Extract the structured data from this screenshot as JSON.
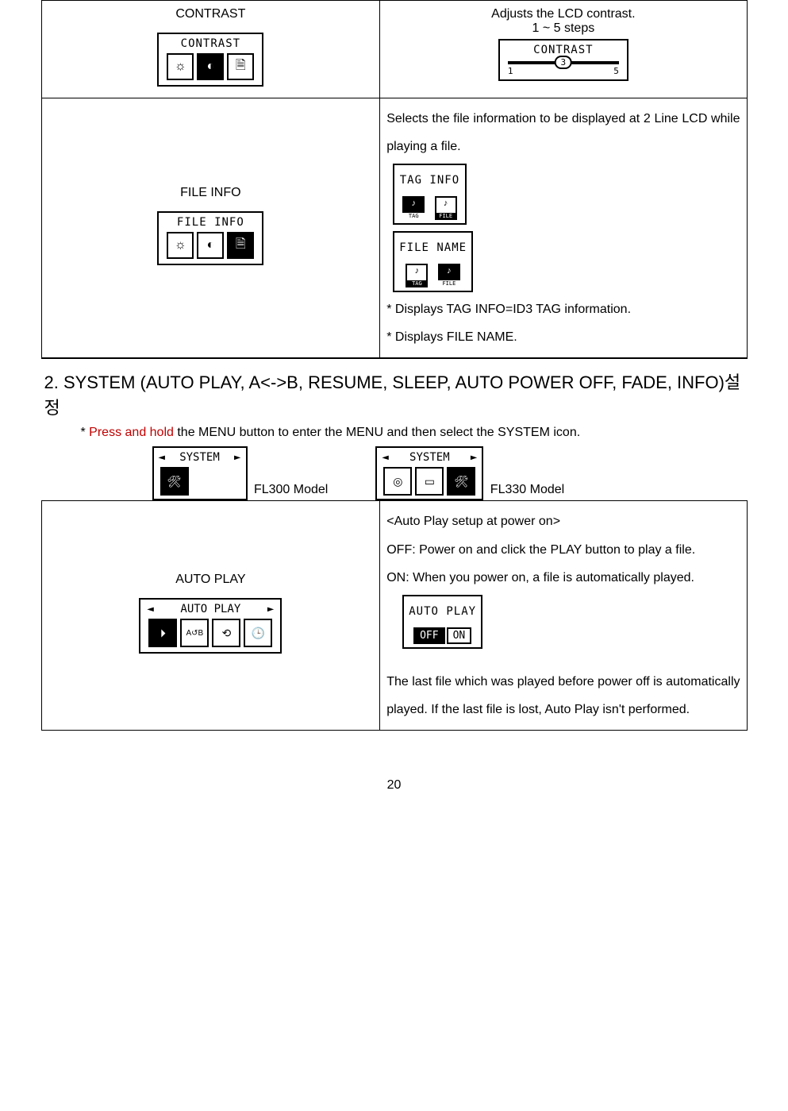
{
  "contrast_row": {
    "title": "CONTRAST",
    "lcd_label": "CONTRAST",
    "desc1": "Adjusts the LCD contrast.",
    "desc2": "1 ~ 5 steps",
    "slider_label": "CONTRAST",
    "slider_value": "3",
    "slider_min": "1",
    "slider_max": "5"
  },
  "fileinfo_row": {
    "title": "FILE INFO",
    "lcd_label": "FILE INFO",
    "desc1": "Selects the file information to be displayed at 2 Line LCD while playing a file.",
    "tag_label": "TAG INFO",
    "file_label": "FILE NAME",
    "tag_caption": "TAG",
    "file_caption": "FILE",
    "note1": "* Displays TAG INFO=ID3 TAG information.",
    "note2": "* Displays FILE NAME."
  },
  "section2": {
    "heading": "2. SYSTEM (AUTO PLAY, A<->B, RESUME, SLEEP, AUTO POWER OFF, FADE, INFO)설정",
    "instruction_star": "* ",
    "instruction_red": "Press and hold",
    "instruction_rest": " the MENU button to enter the MENU and then select the SYSTEM icon.",
    "model1_label": "SYSTEM",
    "model1_name": "FL300 Model",
    "model2_label": "SYSTEM",
    "model2_name": "FL330 Model"
  },
  "autoplay_row": {
    "title": "AUTO PLAY",
    "lcd_label": "AUTO PLAY",
    "desc_heading": "<Auto Play setup at power on>",
    "desc_off": "OFF: Power on and click the PLAY button to play a file.",
    "desc_on": "ON: When you power on, a file is automatically played.",
    "box_label": "AUTO PLAY",
    "box_off": "OFF",
    "box_on": "ON",
    "desc_note": "The last file which was played before power off is automatically played. If the last file is lost, Auto Play isn't performed."
  },
  "page_number": "20"
}
